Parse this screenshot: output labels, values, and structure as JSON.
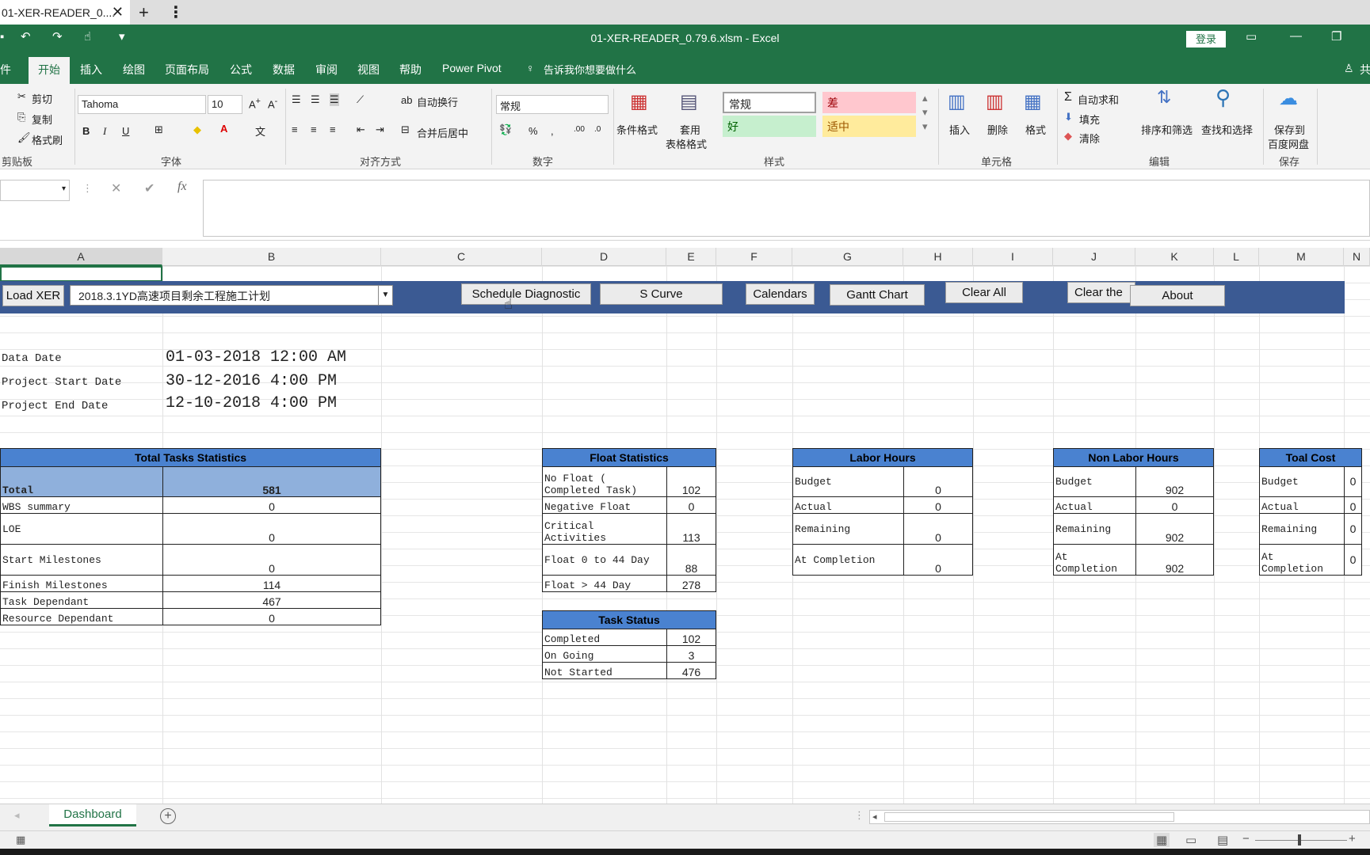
{
  "browser": {
    "tab_title": "01-XER-READER_0....",
    "close": "✕",
    "new_tab": "+",
    "menu": "⋮"
  },
  "titlebar": {
    "title": "01-XER-READER_0.79.6.xlsm  -  Excel",
    "login": "登录"
  },
  "menu": {
    "items": [
      "件",
      "开始",
      "插入",
      "绘图",
      "页面布局",
      "公式",
      "数据",
      "审阅",
      "视图",
      "帮助",
      "Power Pivot"
    ],
    "tell_me": "告诉我你想要做什么",
    "share": "共"
  },
  "ribbon": {
    "clipboard": {
      "cut": "剪切",
      "copy": "复制",
      "format_painter": "格式刷",
      "label": "剪贴板"
    },
    "font": {
      "name": "Tahoma",
      "size": "10",
      "label": "字体"
    },
    "alignment": {
      "wrap": "自动换行",
      "merge": "合并后居中",
      "label": "对齐方式"
    },
    "number": {
      "format": "常规",
      "label": "数字"
    },
    "styles": {
      "conditional": "条件格式",
      "table_fmt_1": "套用",
      "table_fmt_2": "表格格式",
      "normal": "常规",
      "bad": "差",
      "good": "好",
      "neutral": "适中",
      "label": "样式"
    },
    "cells": {
      "insert": "插入",
      "delete": "删除",
      "format": "格式",
      "label": "单元格"
    },
    "editing": {
      "autosum": "自动求和",
      "fill": "填充",
      "clear": "清除",
      "sort": "排序和筛选",
      "find": "查找和选择",
      "label": "编辑"
    },
    "save": {
      "line1": "保存到",
      "line2": "百度网盘",
      "label": "保存"
    }
  },
  "columns": [
    "A",
    "B",
    "C",
    "D",
    "E",
    "F",
    "G",
    "H",
    "I",
    "J",
    "K",
    "L",
    "M",
    "N"
  ],
  "toolbar": {
    "load_xer": "Load XER",
    "project": "2018.3.1YD高速项目剩余工程施工计划",
    "schedule_diagnostic": "Schedule Diagnostic",
    "s_curve": "S Curve",
    "calendars": "Calendars",
    "gantt": "Gantt Chart",
    "clear_all": "Clear All",
    "clear_the": "Clear the",
    "about": "About"
  },
  "dates": {
    "data_date_label": "Data Date",
    "data_date": "01-03-2018 12:00 AM",
    "start_label": "Project Start Date",
    "start": "30-12-2016 4:00 PM",
    "end_label": "Project End Date",
    "end": "12-10-2018 4:00 PM"
  },
  "total_tasks": {
    "title": "Total Tasks Statistics",
    "rows": [
      {
        "label": "Total",
        "value": "581"
      },
      {
        "label": "WBS summary",
        "value": "0"
      },
      {
        "label": "LOE",
        "value": "0"
      },
      {
        "label": "Start Milestones",
        "value": "0"
      },
      {
        "label": "Finish Milestones",
        "value": "114"
      },
      {
        "label": "Task Dependant",
        "value": "467"
      },
      {
        "label": "Resource Dependant",
        "value": "0"
      }
    ]
  },
  "float_stats": {
    "title": "Float Statistics",
    "rows": [
      {
        "label1": "No Float (",
        "label2": "Completed Task)",
        "value": "102"
      },
      {
        "label1": "Negative Float",
        "label2": "",
        "value": "0"
      },
      {
        "label1": "Critical",
        "label2": "Activities",
        "value": "113"
      },
      {
        "label1": "Float 0 to 44 Day",
        "label2": "",
        "value": "88"
      },
      {
        "label1": "Float > 44 Day",
        "label2": "",
        "value": "278"
      }
    ]
  },
  "task_status": {
    "title": "Task Status",
    "rows": [
      {
        "label": "Completed",
        "value": "102"
      },
      {
        "label": "On Going",
        "value": "3"
      },
      {
        "label": "Not Started",
        "value": "476"
      }
    ]
  },
  "labor": {
    "title": "Labor Hours",
    "rows": [
      {
        "label1": "Budget",
        "label2": "",
        "value": "0"
      },
      {
        "label1": "Actual",
        "label2": "",
        "value": "0"
      },
      {
        "label1": "Remaining",
        "label2": "",
        "value": "0"
      },
      {
        "label1": "At Completion",
        "label2": "",
        "value": "0"
      }
    ]
  },
  "nonlabor": {
    "title": "Non Labor Hours",
    "rows": [
      {
        "label1": "Budget",
        "label2": "",
        "value": "902"
      },
      {
        "label1": "Actual",
        "label2": "",
        "value": "0"
      },
      {
        "label1": "Remaining",
        "label2": "",
        "value": "902"
      },
      {
        "label1": "At",
        "label2": "Completion",
        "value": "902"
      }
    ]
  },
  "cost": {
    "title": "Toal Cost",
    "rows": [
      {
        "label1": "Budget",
        "label2": "",
        "value": "0"
      },
      {
        "label1": "Actual",
        "label2": "",
        "value": "0"
      },
      {
        "label1": "Remaining",
        "label2": "",
        "value": "0"
      },
      {
        "label1": "At",
        "label2": "Completion",
        "value": "0"
      }
    ]
  },
  "sheets": {
    "active": "Dashboard",
    "add": "+"
  }
}
